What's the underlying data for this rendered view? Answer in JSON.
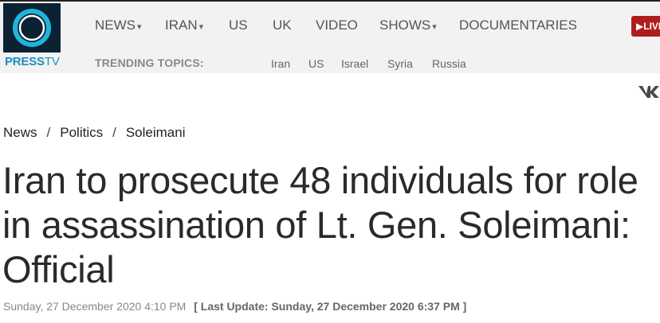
{
  "header": {
    "logo_text_bold": "PRESS",
    "logo_text_thin": "TV",
    "nav": [
      {
        "label": "NEWS",
        "caret": true
      },
      {
        "label": "IRAN",
        "caret": true
      },
      {
        "label": "US",
        "caret": false
      },
      {
        "label": "UK",
        "caret": false
      },
      {
        "label": "VIDEO",
        "caret": false
      },
      {
        "label": "SHOWS",
        "caret": true
      },
      {
        "label": "DOCUMENTARIES",
        "caret": false
      }
    ],
    "live_label": "LIVE",
    "trending_label": "TRENDING TOPICS:",
    "trending": [
      "Iran",
      "US",
      "Israel",
      "Syria",
      "Russia"
    ]
  },
  "article": {
    "breadcrumb": [
      "News",
      "Politics",
      "Soleimani"
    ],
    "title": "Iran to prosecute 48 individuals for role in assassination of Lt. Gen. Soleimani: Official",
    "published": "Sunday, 27 December 2020 4:10 PM",
    "last_update": "[ Last Update: Sunday, 27 December 2020 6:37 PM ]"
  },
  "icons": {
    "logo": "presstv-ring-logo",
    "social": "vk-icon",
    "live": "play-icon"
  },
  "colors": {
    "topbar": "#f2f2f2",
    "logo_bg": "#0a2233",
    "logo_ring": "#1fb6d8",
    "brand_text": "#1a8fc2",
    "live_red": "#b01d1d"
  }
}
